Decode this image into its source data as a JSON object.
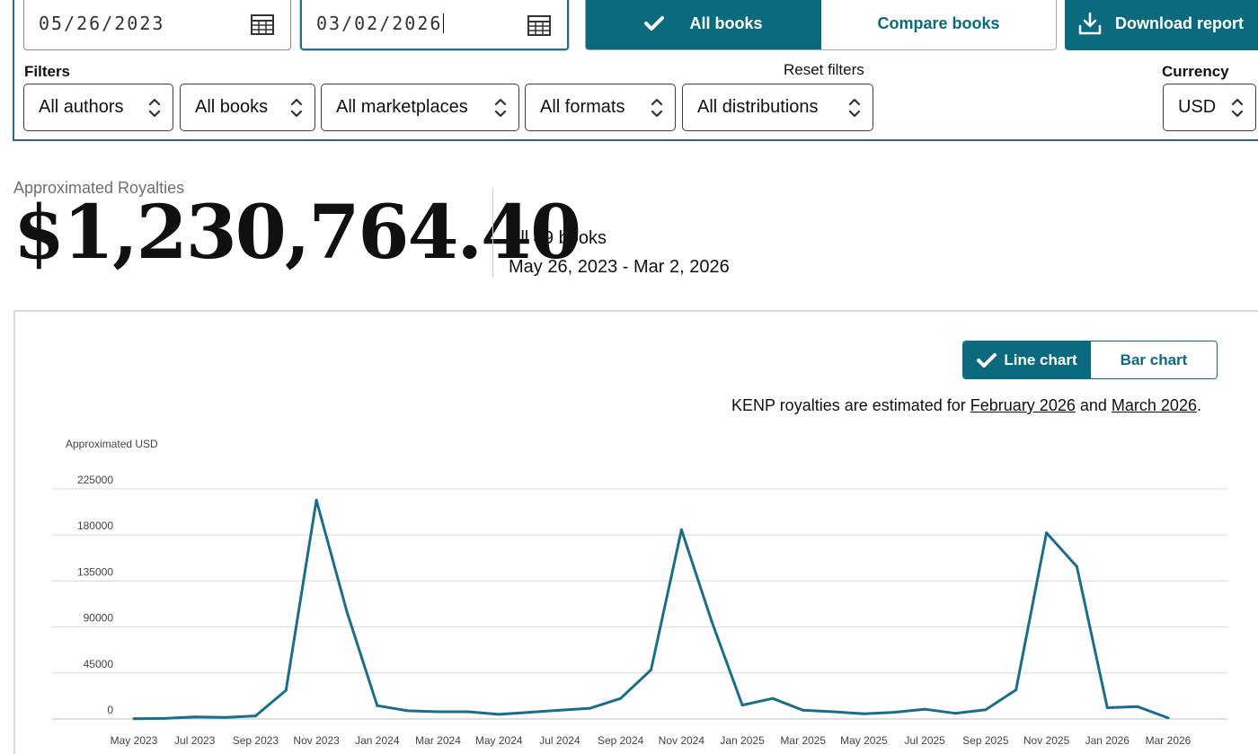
{
  "dates": {
    "start": "05/26/2023",
    "end": "03/02/2026"
  },
  "view_toggle": {
    "all_books": "All books",
    "compare_books": "Compare books"
  },
  "download": {
    "label": "Download report"
  },
  "filters": {
    "label": "Filters",
    "reset": "Reset filters",
    "currency_label": "Currency",
    "authors": "All authors",
    "books": "All books",
    "marketplaces": "All marketplaces",
    "formats": "All formats",
    "distributions": "All distributions",
    "currency": "USD"
  },
  "summary": {
    "label": "Approximated Royalties",
    "amount": "$1,230,764.40",
    "books": "All 49 books",
    "range": "May 26, 2023 - Mar 2, 2026"
  },
  "chart_toggle": {
    "line": "Line chart",
    "bar": "Bar chart",
    "selected": "line"
  },
  "note": {
    "prefix": "KENP royalties are estimated for ",
    "link1": "February 2026",
    "middle": " and ",
    "link2": "March 2026",
    "suffix": "."
  },
  "colors": {
    "accent": "#0b6a7e",
    "line": "#1b6e8a",
    "grid": "#d9d9d9"
  },
  "chart_data": {
    "type": "line",
    "title": "",
    "ylabel": "Approximated USD",
    "xlabel": "",
    "ylim": [
      0,
      225000
    ],
    "yticks": [
      0,
      45000,
      90000,
      135000,
      180000,
      225000
    ],
    "grid": true,
    "x_tick_labels": [
      "May 2023",
      "Jul 2023",
      "Sep 2023",
      "Nov 2023",
      "Jan 2024",
      "Mar 2024",
      "May 2024",
      "Jul 2024",
      "Sep 2024",
      "Nov 2024",
      "Jan 2025",
      "Mar 2025",
      "May 2025",
      "Jul 2025",
      "Sep 2025",
      "Nov 2025",
      "Jan 2026",
      "Mar 2026"
    ],
    "x": [
      "May 2023",
      "Jun 2023",
      "Jul 2023",
      "Aug 2023",
      "Sep 2023",
      "Oct 2023",
      "Nov 2023",
      "Dec 2023",
      "Jan 2024",
      "Feb 2024",
      "Mar 2024",
      "Apr 2024",
      "May 2024",
      "Jun 2024",
      "Jul 2024",
      "Aug 2024",
      "Sep 2024",
      "Oct 2024",
      "Nov 2024",
      "Dec 2024",
      "Jan 2025",
      "Feb 2025",
      "Mar 2025",
      "Apr 2025",
      "May 2025",
      "Jun 2025",
      "Jul 2025",
      "Aug 2025",
      "Sep 2025",
      "Oct 2025",
      "Nov 2025",
      "Dec 2025",
      "Jan 2026",
      "Feb 2026",
      "Mar 2026"
    ],
    "series": [
      {
        "values": [
          300,
          500,
          2000,
          1500,
          3000,
          28000,
          214000,
          105000,
          13000,
          8000,
          7000,
          7000,
          4500,
          6500,
          8500,
          10500,
          20000,
          48000,
          185000,
          95000,
          13500,
          20000,
          8500,
          7000,
          5000,
          6500,
          9500,
          5500,
          9000,
          28500,
          182000,
          149000,
          11000,
          12000,
          1000
        ]
      }
    ]
  }
}
